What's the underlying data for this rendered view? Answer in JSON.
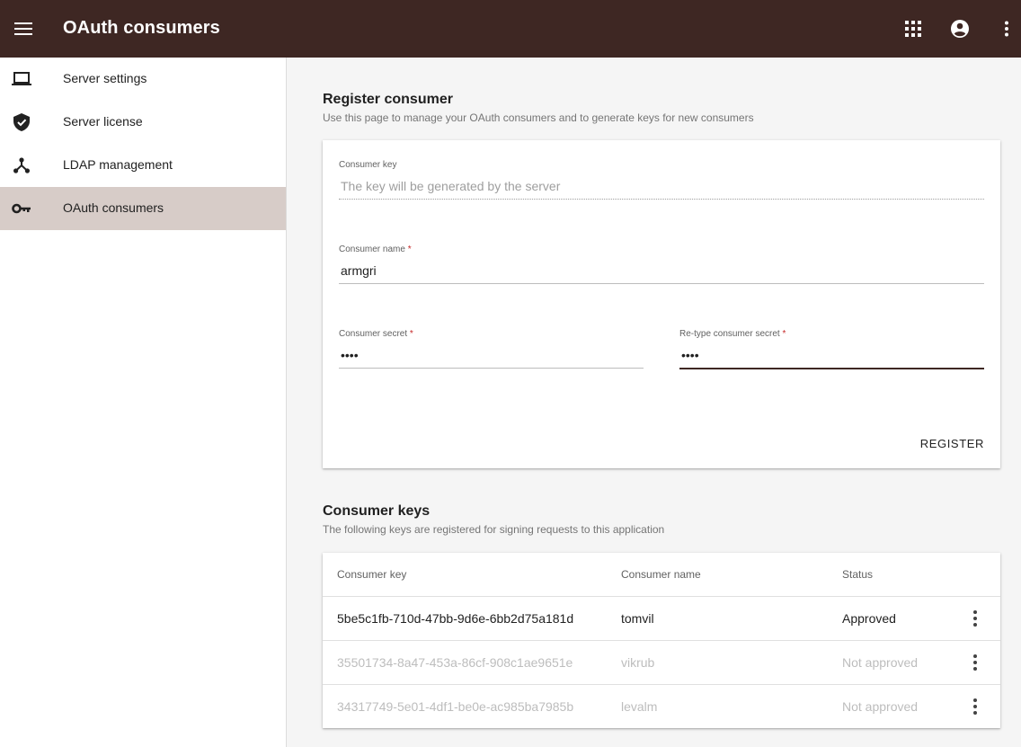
{
  "appbar": {
    "title": "OAuth consumers",
    "icons": [
      "menu-icon",
      "apps-icon",
      "account-circle-icon",
      "more-vert-icon"
    ],
    "color": "#3e2723"
  },
  "sidebar": {
    "items": [
      {
        "label": "Server settings",
        "icon": "laptop-icon",
        "active": false
      },
      {
        "label": "Server license",
        "icon": "verified-shield-icon",
        "active": false
      },
      {
        "label": "LDAP management",
        "icon": "network-icon",
        "active": false
      },
      {
        "label": "OAuth consumers",
        "icon": "key-icon",
        "active": true
      }
    ],
    "active_color": "#d7ccc8"
  },
  "register": {
    "title": "Register consumer",
    "subtitle": "Use this page to manage your OAuth consumers and to generate keys for new consumers",
    "consumer_key": {
      "label": "Consumer key",
      "value": "",
      "placeholder": "The key will be generated by the server"
    },
    "consumer_name": {
      "label": "Consumer name",
      "required_mark": "*",
      "value": "armgri"
    },
    "consumer_secret": {
      "label": "Consumer secret",
      "required_mark": "*",
      "value": "••••"
    },
    "retype_secret": {
      "label": "Re-type consumer secret",
      "required_mark": "*",
      "value": "••••"
    },
    "register_label": "REGISTER"
  },
  "keys": {
    "title": "Consumer keys",
    "subtitle": "The following keys are registered for signing requests to this application",
    "columns": [
      "Consumer key",
      "Consumer name",
      "Status"
    ],
    "rows": [
      {
        "key": "5be5c1fb-710d-47bb-9d6e-6bb2d75a181d",
        "name": "tomvil",
        "status": "Approved"
      },
      {
        "key": "35501734-8a47-453a-86cf-908c1ae9651e",
        "name": "vikrub",
        "status": "Not approved"
      },
      {
        "key": "34317749-5e01-4df1-be0e-ac985ba7985b",
        "name": "levalm",
        "status": "Not approved"
      }
    ]
  }
}
